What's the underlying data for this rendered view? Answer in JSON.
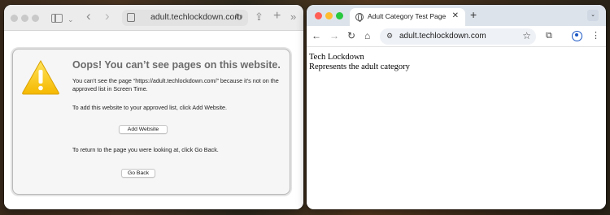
{
  "safari": {
    "address": "adult.techlockdown.com",
    "block_page": {
      "title": "Oops! You can’t see pages on this website.",
      "message": "You can’t see the page “https://adult.techlockdown.com/” because it’s not on the approved list in Screen Time.",
      "add_instruction": "To add this website to your approved list, click Add Website.",
      "add_button": "Add Website",
      "back_instruction": "To return to the page you were looking at, click Go Back.",
      "back_button": "Go Back"
    }
  },
  "chrome": {
    "tab_title": "Adult Category Test Page",
    "address": "adult.techlockdown.com",
    "page": {
      "heading": "Tech Lockdown",
      "description": "Represents the adult category"
    }
  }
}
